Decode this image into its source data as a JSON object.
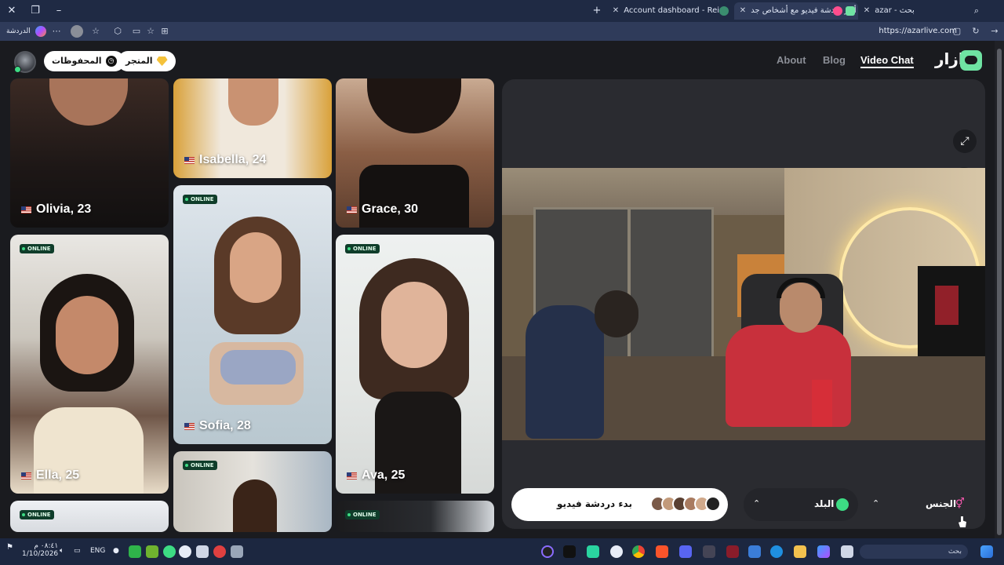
{
  "browser": {
    "tabs": [
      {
        "title": "Account dashboard - Reincubate",
        "active": false
      },
      {
        "title": "أزار دردشة فيديو مع أشخاص جد",
        "active": true
      },
      {
        "title": "azar - بحث",
        "active": false
      }
    ],
    "new_tab_label": "+",
    "url": "https://azarlive.com",
    "chat_button_label": "الدردشة"
  },
  "header": {
    "logo_text": "ازار",
    "nav": [
      {
        "label": "Video Chat",
        "active": true
      },
      {
        "label": "Blog",
        "active": false
      },
      {
        "label": "About",
        "active": false
      }
    ],
    "saved_label": "المحفوظات",
    "shop_label": "المتجر"
  },
  "gallery": {
    "cards": [
      {
        "name": "Olivia, 23",
        "online": false
      },
      {
        "name": "Isabella, 24",
        "online": false
      },
      {
        "name": "Grace, 30",
        "online": false
      },
      {
        "name": "Ella, 25",
        "online": true
      },
      {
        "name": "Sofia, 28",
        "online": true
      },
      {
        "name": "Ava, 25",
        "online": true
      },
      {
        "name": "",
        "online": true
      },
      {
        "name": "",
        "online": true
      },
      {
        "name": "",
        "online": true
      }
    ],
    "online_label": "ONLINE"
  },
  "video": {
    "start_button_label": "بدء دردشة فيديو",
    "country_label": "البلد",
    "gender_label": "الجنس"
  },
  "taskbar": {
    "search_placeholder": "بحث",
    "language": "ENG",
    "time": "٠٨:٤١ م",
    "date": "1/10/2026"
  },
  "colors": {
    "page_bg": "#1a1b1f",
    "accent_green": "#3ddc84",
    "logo_green": "#6fe3a3",
    "online_badge_bg": "#0f3d2a"
  }
}
